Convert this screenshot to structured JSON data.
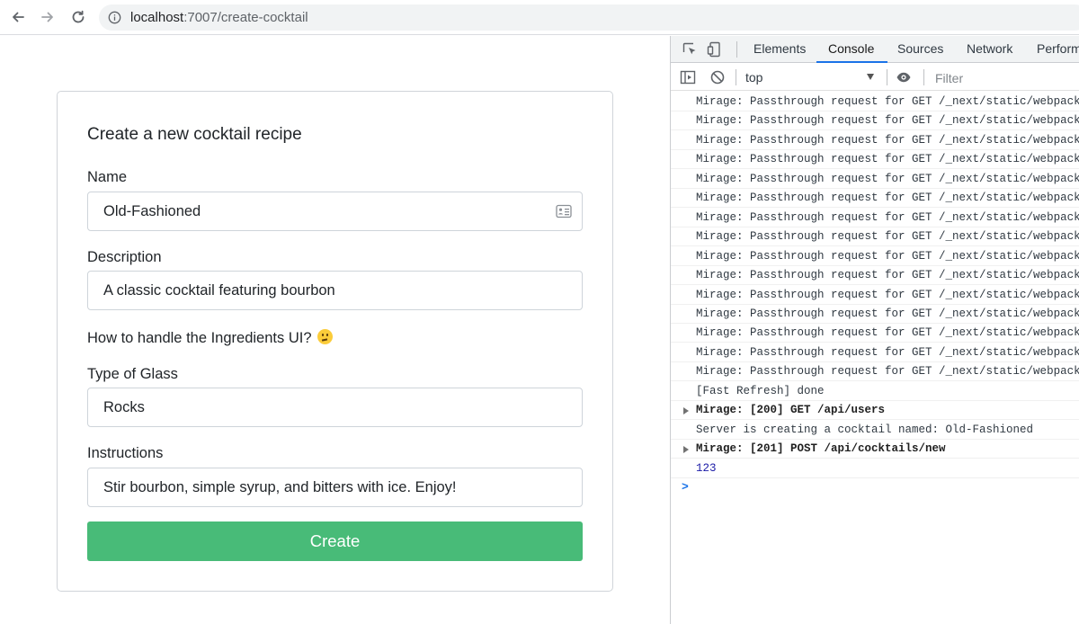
{
  "browser": {
    "url_host": "localhost",
    "url_path": ":7007/create-cocktail"
  },
  "form": {
    "title": "Create a new cocktail recipe",
    "name_label": "Name",
    "name_value": "Old-Fashioned",
    "description_label": "Description",
    "description_value": "A classic cocktail featuring bourbon",
    "ingredients_note": "How to handle the Ingredients UI?",
    "glass_label": "Type of Glass",
    "glass_value": "Rocks",
    "instructions_label": "Instructions",
    "instructions_value": "Stir bourbon, simple syrup, and bitters with ice. Enjoy!",
    "create_label": "Create"
  },
  "devtools": {
    "tabs": [
      "Elements",
      "Console",
      "Sources",
      "Network",
      "Perform"
    ],
    "active_tab": "Console",
    "context": "top",
    "filter_placeholder": "Filter",
    "logs": [
      {
        "text": "Mirage: Passthrough request for GET /_next/static/webpack",
        "style": "normal"
      },
      {
        "text": "Mirage: Passthrough request for GET /_next/static/webpack",
        "style": "normal"
      },
      {
        "text": "Mirage: Passthrough request for GET /_next/static/webpack",
        "style": "normal"
      },
      {
        "text": "Mirage: Passthrough request for GET /_next/static/webpack",
        "style": "normal"
      },
      {
        "text": "Mirage: Passthrough request for GET /_next/static/webpack",
        "style": "normal"
      },
      {
        "text": "Mirage: Passthrough request for GET /_next/static/webpack",
        "style": "normal"
      },
      {
        "text": "Mirage: Passthrough request for GET /_next/static/webpack",
        "style": "normal"
      },
      {
        "text": "Mirage: Passthrough request for GET /_next/static/webpack",
        "style": "normal"
      },
      {
        "text": "Mirage: Passthrough request for GET /_next/static/webpack",
        "style": "normal"
      },
      {
        "text": "Mirage: Passthrough request for GET /_next/static/webpack",
        "style": "normal"
      },
      {
        "text": "Mirage: Passthrough request for GET /_next/static/webpack",
        "style": "normal"
      },
      {
        "text": "Mirage: Passthrough request for GET /_next/static/webpack",
        "style": "normal"
      },
      {
        "text": "Mirage: Passthrough request for GET /_next/static/webpack",
        "style": "normal"
      },
      {
        "text": "Mirage: Passthrough request for GET /_next/static/webpack",
        "style": "normal"
      },
      {
        "text": "Mirage: Passthrough request for GET /_next/static/webpack",
        "style": "normal"
      },
      {
        "text": "[Fast Refresh] done",
        "style": "normal"
      },
      {
        "text": "Mirage: [200] GET /api/users",
        "style": "bold"
      },
      {
        "text": "Server is creating a cocktail named:  Old-Fashioned",
        "style": "normal"
      },
      {
        "text": "Mirage: [201] POST /api/cocktails/new",
        "style": "bold"
      },
      {
        "text": "123",
        "style": "num"
      }
    ],
    "prompt": ">"
  },
  "colors": {
    "accent": "#48bb78",
    "devtools_active": "#1a73e8"
  }
}
